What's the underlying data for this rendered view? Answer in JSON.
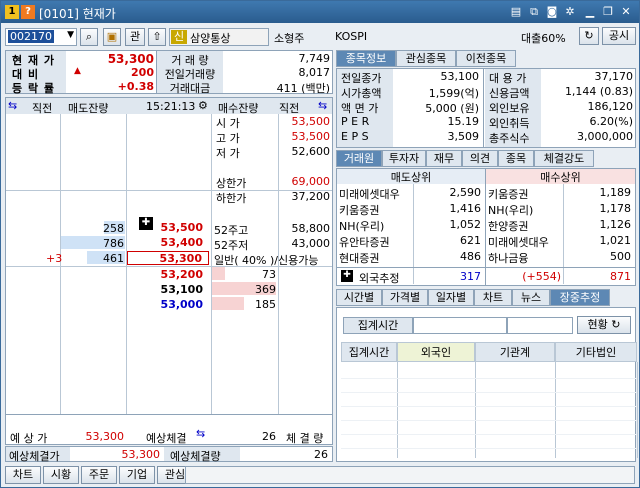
{
  "window": {
    "number_badge": "1",
    "help_badge": "?",
    "title": "[0101] 현재가"
  },
  "toolbar": {
    "code": "002170",
    "btn_gwan": "관",
    "corp_label": "삼양통상",
    "size_tag": "소형주",
    "market": "KOSPI",
    "loan": "대출60%",
    "notice": "공시",
    "corp_badge": "신"
  },
  "price": {
    "cur_label": "현 재 가",
    "cur": "53,300",
    "diff_label": "대 비",
    "diff_arrow": "▲",
    "diff": "200",
    "rate_label": "등 락 률",
    "rate": "+0.38",
    "vol_label": "거 래 량",
    "vol": "7,749",
    "prevvol_label": "전일거래량",
    "prevvol": "8,017",
    "amt_label": "거래대금",
    "amt": "411 (백만)"
  },
  "orderbook": {
    "h_prev": "직전",
    "h_ask": "매도잔량",
    "time": "15:21:13",
    "h_bid": "매수잔량",
    "h_prev2": "직전",
    "info": [
      {
        "l": "시 가",
        "v": "53,500"
      },
      {
        "l": "고 가",
        "v": "53,500"
      },
      {
        "l": "저 가",
        "v": "52,600"
      },
      {
        "l": "",
        "v": ""
      },
      {
        "l": "상한가",
        "v": "69,000"
      },
      {
        "l": "하한가",
        "v": "37,200"
      }
    ],
    "asks": [
      {
        "qty": "258",
        "price": "53,500"
      },
      {
        "qty": "786",
        "price": "53,400"
      },
      {
        "qty": "461",
        "price": "53,300",
        "chg": "+3"
      }
    ],
    "ask_bars": [
      0.33,
      1.0,
      0.59
    ],
    "bids": [
      {
        "qty": "73",
        "price": "53,200"
      },
      {
        "qty": "369",
        "price": "53,100"
      },
      {
        "qty": "185",
        "price": "53,000"
      }
    ],
    "bid_bars": [
      0.2,
      1.0,
      0.5
    ],
    "extra": [
      {
        "l": "52주고",
        "v": "58,800"
      },
      {
        "l": "52주저",
        "v": "43,000"
      },
      {
        "l": "일반( 40% )/신용가능",
        "v": ""
      }
    ],
    "footer": {
      "exp_label": "예 상 가",
      "exp": "53,300",
      "exp_fill_label": "예상체결",
      "exp_fill": "26",
      "fill_label": "체 결 량"
    }
  },
  "bottom": {
    "exp_price_label": "예상체결가",
    "exp_price": "53,300",
    "exp_qty_label": "예상체결량",
    "exp_qty": "26"
  },
  "footer_btns": [
    "차트",
    "시황",
    "주문",
    "기업",
    "관심"
  ],
  "info_tabs": [
    "종목정보",
    "관심종목",
    "이전종목"
  ],
  "info": {
    "left": [
      {
        "l": "전일종가",
        "v": "53,100"
      },
      {
        "l": "시가총액",
        "v": "1,599(억)"
      },
      {
        "l": "액 면 가",
        "v": "5,000 (원)"
      },
      {
        "l": "P E R",
        "v": "15.19"
      },
      {
        "l": "E P S",
        "v": "3,509"
      }
    ],
    "right": [
      {
        "l": "대 용 가",
        "v": "37,170"
      },
      {
        "l": "신용금액",
        "v": "1,144  (0.83)"
      },
      {
        "l": "외인보유",
        "v": "186,120"
      },
      {
        "l": "외인취득",
        "v": "6.20(%)"
      },
      {
        "l": "총주식수",
        "v": "3,000,000"
      }
    ]
  },
  "broker_tabs": [
    "거래원",
    "투자자",
    "재무",
    "의견",
    "종목",
    "체결강도"
  ],
  "broker": {
    "sell_hdr": "매도상위",
    "buy_hdr": "매수상위",
    "rows": [
      {
        "s": "미래에셋대우",
        "sv": "2,590",
        "b": "키움증권",
        "bv": "1,189"
      },
      {
        "s": "키움증권",
        "sv": "1,416",
        "b": "NH(우리)",
        "bv": "1,178"
      },
      {
        "s": "NH(우리)",
        "sv": "1,052",
        "b": "한양증권",
        "bv": "1,126"
      },
      {
        "s": "유안타증권",
        "sv": "621",
        "b": "미래에셋대우",
        "bv": "1,021"
      },
      {
        "s": "현대증권",
        "sv": "486",
        "b": "하나금융",
        "bv": "500"
      }
    ],
    "foreign_label": "외국추정",
    "foreign_sell": "317",
    "foreign_net": "(+554)",
    "foreign_buy": "871"
  },
  "time_tabs": [
    "시간별",
    "가격별",
    "일자별",
    "차트",
    "뉴스",
    "장중추정"
  ],
  "est": {
    "agg_label": "집계시간",
    "now_btn": "현황",
    "cols": [
      "집계시간",
      "외국인",
      "기관계",
      "기타법인"
    ]
  }
}
